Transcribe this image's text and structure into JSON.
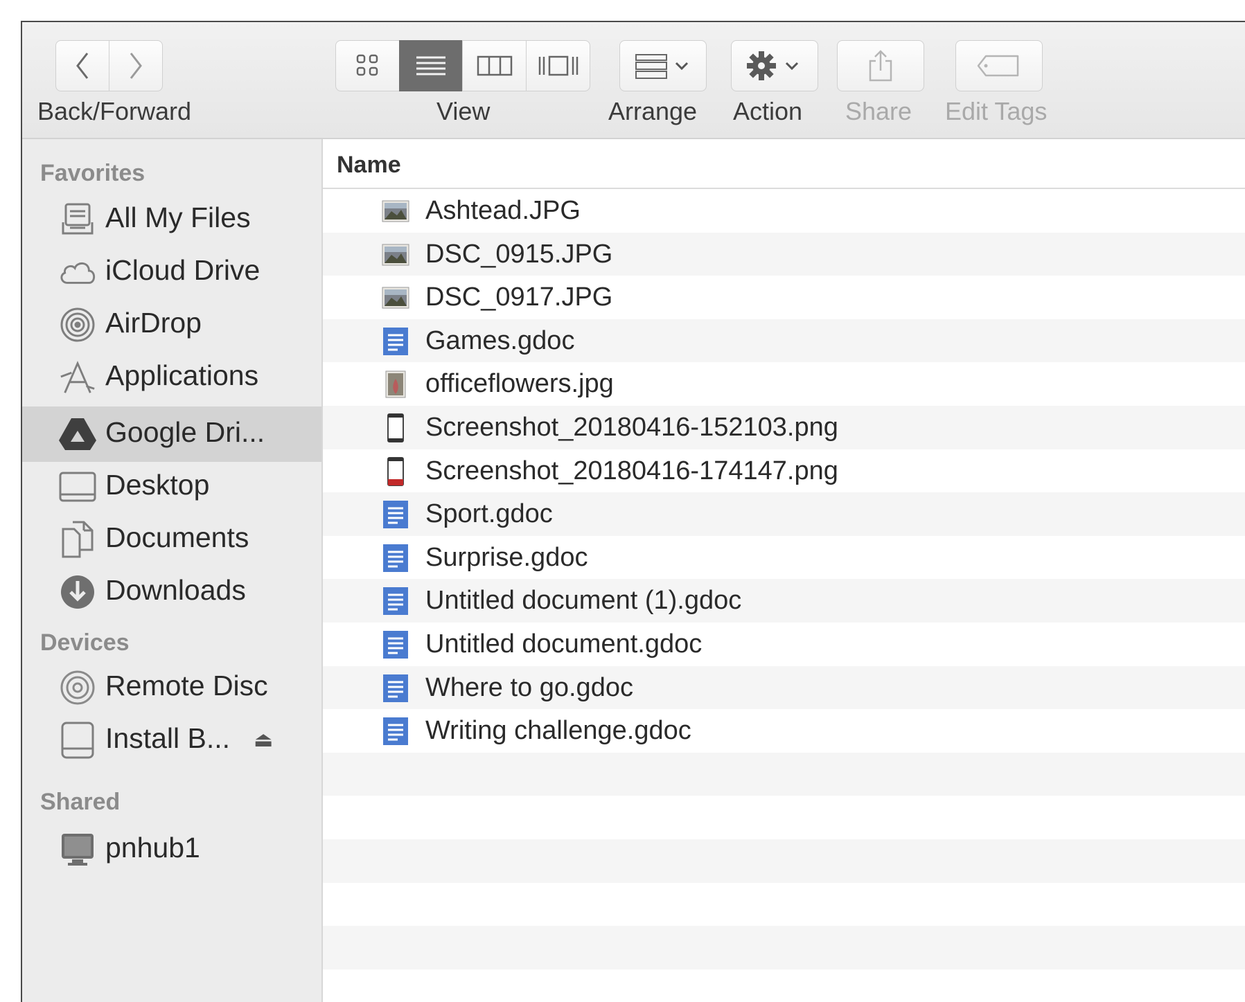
{
  "toolbar": {
    "back_forward_label": "Back/Forward",
    "view_label": "View",
    "arrange_label": "Arrange",
    "action_label": "Action",
    "share_label": "Share",
    "edit_tags_label": "Edit Tags",
    "active_view": "list"
  },
  "sidebar": {
    "favorites_heading": "Favorites",
    "favorites": [
      {
        "label": "All My Files",
        "icon": "all-files-icon"
      },
      {
        "label": "iCloud Drive",
        "icon": "cloud-icon"
      },
      {
        "label": "AirDrop",
        "icon": "airdrop-icon"
      },
      {
        "label": "Applications",
        "icon": "applications-icon"
      },
      {
        "label": "Google Dri...",
        "icon": "google-drive-icon",
        "selected": true
      },
      {
        "label": "Desktop",
        "icon": "desktop-icon"
      },
      {
        "label": "Documents",
        "icon": "documents-icon"
      },
      {
        "label": "Downloads",
        "icon": "downloads-icon"
      }
    ],
    "devices_heading": "Devices",
    "devices": [
      {
        "label": "Remote Disc",
        "icon": "disc-icon"
      },
      {
        "label": "Install B...",
        "icon": "drive-icon",
        "eject": "⏏"
      }
    ],
    "shared_heading": "Shared",
    "shared": [
      {
        "label": "pnhub1",
        "icon": "computer-icon"
      }
    ]
  },
  "list": {
    "column_name": "Name",
    "files": [
      {
        "name": "Ashtead.JPG",
        "type": "image"
      },
      {
        "name": "DSC_0915.JPG",
        "type": "image"
      },
      {
        "name": "DSC_0917.JPG",
        "type": "image"
      },
      {
        "name": "Games.gdoc",
        "type": "gdoc"
      },
      {
        "name": "officeflowers.jpg",
        "type": "image-portrait"
      },
      {
        "name": "Screenshot_20180416-152103.png",
        "type": "phone"
      },
      {
        "name": "Screenshot_20180416-174147.png",
        "type": "phone-red"
      },
      {
        "name": "Sport.gdoc",
        "type": "gdoc"
      },
      {
        "name": "Surprise.gdoc",
        "type": "gdoc"
      },
      {
        "name": "Untitled document (1).gdoc",
        "type": "gdoc"
      },
      {
        "name": "Untitled document.gdoc",
        "type": "gdoc"
      },
      {
        "name": "Where to go.gdoc",
        "type": "gdoc"
      },
      {
        "name": "Writing challenge.gdoc",
        "type": "gdoc"
      }
    ]
  },
  "colors": {
    "gdoc_blue": "#4a7bd0",
    "sidebar_bg": "#ececec",
    "selected_bg": "#d3d3d3"
  }
}
